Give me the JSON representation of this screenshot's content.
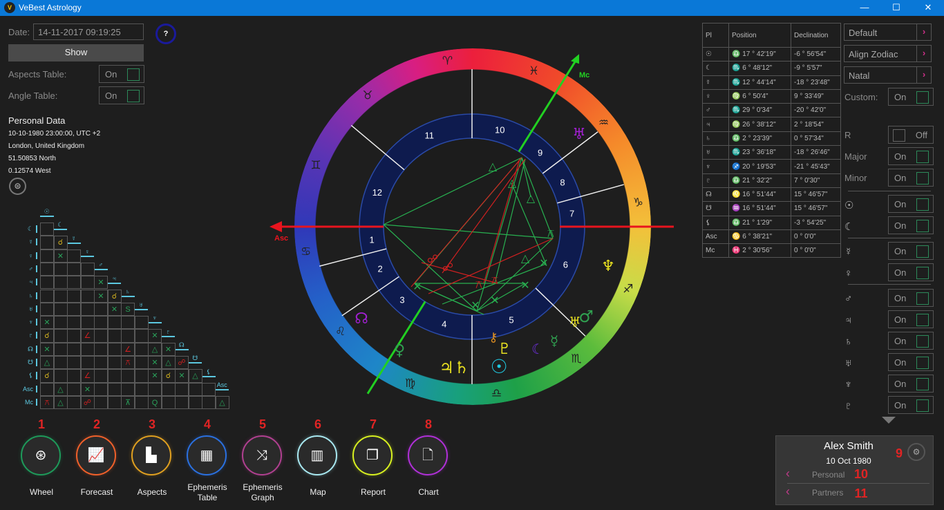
{
  "app": {
    "title": "VeBest Astrology",
    "logo": "VA"
  },
  "left": {
    "date_label": "Date:",
    "date_value": "14-11-2017 09:19:25",
    "show_label": "Show",
    "help": "?",
    "aspects_table_label": "Aspects Table:",
    "aspects_table_state": "On",
    "angle_table_label": "Angle Table:",
    "angle_table_state": "On",
    "personal_title": "Personal Data",
    "personal_lines": [
      "10-10-1980 23:00:00, UTC +2",
      "London, United Kingdom",
      "51.50853 North",
      "0.12574 West"
    ]
  },
  "aspect_grid": {
    "col_labels": [
      "☉",
      "☾",
      "☿",
      "♀",
      "♂",
      "♃",
      "♄",
      "♅",
      "♆",
      "♇",
      "☊",
      "☋",
      "⚸",
      "Asc"
    ],
    "row_labels": [
      "☾",
      "☿",
      "♀",
      "♂",
      "♃",
      "♄",
      "♅",
      "♆",
      "♇",
      "☊",
      "☋",
      "⚸",
      "Asc",
      "Mc"
    ],
    "rows": [
      [
        ""
      ],
      [
        "",
        "c"
      ],
      [
        "",
        "x",
        ""
      ],
      [
        "",
        "",
        "",
        ""
      ],
      [
        "",
        "",
        "",
        "",
        "x"
      ],
      [
        "",
        "",
        "",
        "",
        "x",
        "c"
      ],
      [
        "",
        "",
        "",
        "",
        "",
        "x",
        "S"
      ],
      [
        "x",
        "",
        "",
        "",
        "",
        "",
        "",
        ""
      ],
      [
        "c",
        "",
        "",
        "s",
        "",
        "",
        "",
        "",
        "x"
      ],
      [
        "x",
        "",
        "",
        "",
        "",
        "",
        "s",
        "",
        "t",
        "x"
      ],
      [
        "t",
        "",
        "",
        "",
        "",
        "",
        "q",
        "",
        "x",
        "t",
        "o"
      ],
      [
        "c",
        "",
        "",
        "s",
        "",
        "",
        "",
        "",
        "x",
        "c",
        "x",
        "t"
      ],
      [
        "",
        "t",
        "",
        "x",
        "",
        "",
        "",
        "",
        "",
        "",
        "",
        "",
        ""
      ],
      [
        "q",
        "t",
        "",
        "o",
        "",
        "",
        "b",
        "",
        "Q",
        "",
        "",
        "",
        "",
        "t"
      ]
    ]
  },
  "planets_table": {
    "headers": [
      "Pl",
      "Position",
      "Declination"
    ],
    "rows": [
      [
        "☉",
        "♎ 17 ° 42'19\"",
        "-6 ° 56'54\""
      ],
      [
        "☾",
        "♏ 6 ° 48'12\"",
        "-9 ° 5'57\""
      ],
      [
        "☿",
        "♏ 12 ° 44'14\"",
        "-18 ° 23'48\""
      ],
      [
        "♀",
        "♍ 6 ° 50'4\"",
        "9 ° 33'49\""
      ],
      [
        "♂",
        "♏ 29 ° 0'34\"",
        "-20 ° 42'0\""
      ],
      [
        "♃",
        "♍ 26 ° 38'12\"",
        "2 ° 18'54\""
      ],
      [
        "♄",
        "♎ 2 ° 23'39\"",
        "0 ° 57'34\""
      ],
      [
        "♅",
        "♏ 23 ° 36'18\"",
        "-18 ° 26'46\""
      ],
      [
        "♆",
        "♐ 20 ° 19'53\"",
        "-21 ° 45'43\""
      ],
      [
        "♇",
        "♎ 21 ° 32'2\"",
        "7 ° 0'30\""
      ],
      [
        "☊",
        "♌ 16 ° 51'44\"",
        "15 ° 46'57\""
      ],
      [
        "☋",
        "♒ 16 ° 51'44\"",
        "15 ° 46'57\""
      ],
      [
        "⚸",
        "♎ 21 ° 1'29\"",
        "-3 ° 54'25\""
      ],
      [
        "Asc",
        "♋ 6 ° 38'21\"",
        "0 ° 0'0\""
      ],
      [
        "Mc",
        "♓ 2 ° 30'56\"",
        "0 ° 0'0\""
      ]
    ]
  },
  "right": {
    "selectors": [
      "Default",
      "Align Zodiac",
      "Natal"
    ],
    "custom_label": "Custom:",
    "custom_state": "On",
    "toggles": [
      {
        "label": "R",
        "state": "Off"
      },
      {
        "label": "Major",
        "state": "On"
      },
      {
        "label": "Minor",
        "state": "On"
      },
      {
        "label": "☉",
        "state": "On"
      },
      {
        "label": "☾",
        "state": "On"
      },
      {
        "label": "☿",
        "state": "On"
      },
      {
        "label": "♀",
        "state": "On"
      },
      {
        "label": "♂",
        "state": "On"
      },
      {
        "label": "♃",
        "state": "On"
      },
      {
        "label": "♄",
        "state": "On"
      },
      {
        "label": "♅",
        "state": "On"
      },
      {
        "label": "♆",
        "state": "On"
      },
      {
        "label": "♇",
        "state": "On"
      }
    ]
  },
  "wheel": {
    "asc_label": "Asc",
    "mc_label": "Mc",
    "houses": [
      "1",
      "2",
      "3",
      "4",
      "5",
      "6",
      "7",
      "8",
      "9",
      "10",
      "11",
      "12"
    ],
    "signs": [
      "♈",
      "♉",
      "♊",
      "♋",
      "♌",
      "♍",
      "♎",
      "♏",
      "♐",
      "♑",
      "♒",
      "♓"
    ],
    "planet_glyphs": [
      {
        "g": "♅",
        "c": "#a020d0"
      },
      {
        "g": "♆",
        "c": "#e8e020"
      },
      {
        "g": "♂",
        "c": "#30a050"
      },
      {
        "g": "♅",
        "c": "#e8e020"
      },
      {
        "g": "☿",
        "c": "#30a050"
      },
      {
        "g": "☾",
        "c": "#7030e0"
      },
      {
        "g": "♇",
        "c": "#e8e020"
      },
      {
        "g": "⚷",
        "c": "#e09020"
      },
      {
        "g": "☉",
        "c": "#20c8e0"
      },
      {
        "g": "♃♄",
        "c": "#e8e020"
      },
      {
        "g": "♀",
        "c": "#30a050"
      },
      {
        "g": "☊",
        "c": "#a020d0"
      }
    ]
  },
  "nav": [
    {
      "n": "1",
      "label": "Wheel",
      "icon": "wheel-icon",
      "glyph": "⊛",
      "color": "#1e9a5a"
    },
    {
      "n": "2",
      "label": "Forecast",
      "icon": "line-chart-icon",
      "glyph": "📈",
      "color": "#f0602a"
    },
    {
      "n": "3",
      "label": "Aspects",
      "icon": "bar-steps-icon",
      "glyph": "▙",
      "color": "#e0a020"
    },
    {
      "n": "4",
      "label": "Ephemeris Table",
      "icon": "table-icon",
      "glyph": "▦",
      "color": "#2a70e0"
    },
    {
      "n": "5",
      "label": "Ephemeris Graph",
      "icon": "shuffle-chart-icon",
      "glyph": "⤨",
      "color": "#b04090"
    },
    {
      "n": "6",
      "label": "Map",
      "icon": "map-icon",
      "glyph": "▥",
      "color": "#a8e8f0"
    },
    {
      "n": "7",
      "label": "Report",
      "icon": "copy-icon",
      "glyph": "❐",
      "color": "#d8f020"
    },
    {
      "n": "8",
      "label": "Chart",
      "icon": "document-icon",
      "glyph": "🗋",
      "color": "#b030d8"
    }
  ],
  "profile": {
    "name": "Alex Smith",
    "date": "10 Oct 1980",
    "settings_num": "9",
    "personal": "Personal",
    "personal_num": "10",
    "partners": "Partners",
    "partners_num": "11"
  },
  "colors": {
    "titlebar": "#0a78d7",
    "asc_line": "#e8141e",
    "mc_line": "#22d022",
    "accent_arrow": "#d0308a"
  }
}
